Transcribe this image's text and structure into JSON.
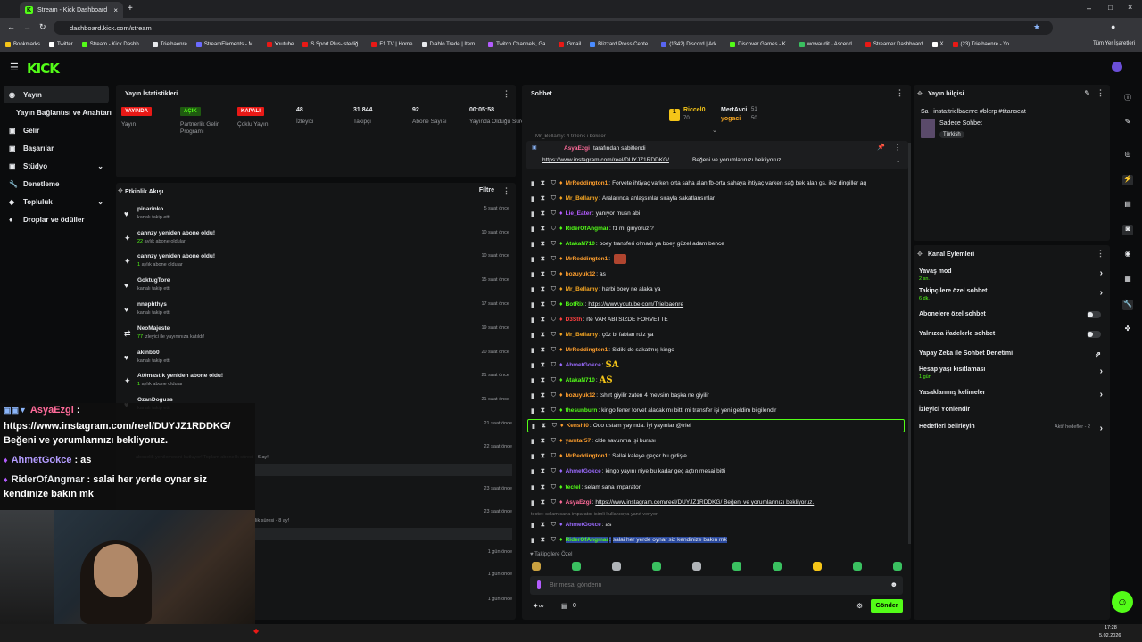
{
  "browser": {
    "tab_title": "Stream - Kick Dashboard",
    "url": "dashboard.kick.com/stream",
    "bookmarks": [
      "Bookmarks",
      "Twitter",
      "Stream - Kick Dashb...",
      "Trielbaenre",
      "StreamElements - M...",
      "Youtube",
      "S Sport Plus-İstediğ...",
      "F1 TV | Home",
      "Diablo Trade | Item...",
      "Twitch Channels, Ga...",
      "Gmail",
      "Blizzard Press Cente...",
      "(1342) Discord | Ark...",
      "Discover Games - K...",
      "wowaudit - Ascend...",
      "Streamer Dashboard",
      "X",
      "(23) Trielbaenre - Yo..."
    ],
    "bookmarks_right": "Tüm Yer İşaretleri"
  },
  "app": {
    "logo": "KICK"
  },
  "sidebar": {
    "items": [
      {
        "label": "Yayın"
      },
      {
        "label": "Yayın Bağlantısı ve Anahtarı"
      },
      {
        "label": "Gelir"
      },
      {
        "label": "Başarılar"
      },
      {
        "label": "Stüdyo"
      },
      {
        "label": "Denetleme"
      },
      {
        "label": "Topluluk"
      },
      {
        "label": "Droplar ve ödüller"
      }
    ]
  },
  "stats": {
    "title": "Yayın İstatistikleri",
    "items": [
      {
        "badge": "YAYINDA",
        "label": "Yayın",
        "color": "#e91916"
      },
      {
        "badge": "AÇIK",
        "label": "Partnerlik Gelir Programı",
        "color": "#53fc18"
      },
      {
        "badge": "KAPALI",
        "label": "Çoklu Yayın",
        "color": "#e91916"
      },
      {
        "value": "48",
        "label": "İzleyici"
      },
      {
        "value": "31.844",
        "label": "Takipçi"
      },
      {
        "value": "92",
        "label": "Abone Sayısı"
      },
      {
        "value": "00:05:58",
        "label": "Yayında Olduğu Süre"
      }
    ]
  },
  "activity": {
    "title": "Etkinlik Akışı",
    "filter": "Filtre",
    "items": [
      {
        "name": "pinarinko",
        "detail": "kanalı takip etti",
        "time": "5 saat önce",
        "icon": "♥"
      },
      {
        "name": "cannzy yeniden abone oldu!",
        "hl": "22",
        "detail": "aylık abone oldular",
        "time": "10 saat önce",
        "icon": "✦"
      },
      {
        "name": "cannzy yeniden abone oldu!",
        "hl": "1",
        "detail": "aylık abone oldular",
        "time": "10 saat önce",
        "icon": "✦"
      },
      {
        "name": "GoktugTore",
        "detail": "kanalı takip etti",
        "time": "15 saat önce",
        "icon": "♥"
      },
      {
        "name": "nnephthys",
        "detail": "kanalı takip etti",
        "time": "17 saat önce",
        "icon": "♥"
      },
      {
        "name": "NeoMajeste",
        "hl": "77",
        "detail": "izleyici ile yayınınıza katıldı!",
        "time": "19 saat önce",
        "icon": "⇄"
      },
      {
        "name": "akinbb0",
        "detail": "kanalı takip etti",
        "time": "20 saat önce",
        "icon": "♥"
      },
      {
        "name": "At0mastik yeniden abone oldu!",
        "hl": "1",
        "detail": "aylık abone oldular",
        "time": "21 saat önce",
        "icon": "✦"
      },
      {
        "name": "OzanDoguss",
        "detail": "kanalı takip etti",
        "time": "21 saat önce",
        "icon": "♥"
      }
    ],
    "extra_times": [
      "21 saat önce",
      "22 saat önce",
      "23 saat önce",
      "23 saat önce",
      "1 gün önce",
      "1 gün önce",
      "1 gün önce"
    ],
    "partial_texts": [
      "abonelik yenilemesini kutluyor! Toplam abonelik süresi - 6 ay!",
      "lik süresi - 8 ay!"
    ]
  },
  "chat": {
    "title": "Sohbet",
    "leaders": [
      {
        "name": "Riccel0",
        "score": "70"
      },
      {
        "name": "MertAvci",
        "score": "51"
      },
      {
        "name": "yogaci",
        "score": "50"
      }
    ],
    "pinned": {
      "by": "AsyaEzgi",
      "by_suffix": "tarafından sabitlendi",
      "link": "https://www.instagram.com/reel/DUYJZ1RDDKG/",
      "text": "Beğeni ve yorumlarınızı bekliyoruz."
    },
    "partial_top": "Mr_Bellamy: 4 trilenk i boksor",
    "messages": [
      {
        "user": "MrReddington1",
        "color": "#ff9f2e",
        "text": "Forvete ihtiyaç varken orta saha alan fb-orta sahaya ihtiyaç varken sağ bek alan gs, ikiz dingiller aq"
      },
      {
        "user": "Mr_Bellamy",
        "color": "#f5a623",
        "text": "Aralarında anlaşsınlar sırayla sakatlansınlar"
      },
      {
        "user": "Lie_Eater",
        "color": "#b45cff",
        "text": "yanıyor musn abi"
      },
      {
        "user": "RiderOfAngmar",
        "color": "#53fc18",
        "text": "f1 mi giriyoruz ?"
      },
      {
        "user": "AtakaN710",
        "color": "#53fc18",
        "text": "boey transferi olmadı ya boey güzel adam bence"
      },
      {
        "user": "MrReddington1",
        "color": "#ff9f2e",
        "text": ""
      },
      {
        "user": "bozuyuk12",
        "color": "#ff9f2e",
        "text": "as"
      },
      {
        "user": "Mr_Bellamy",
        "color": "#f5a623",
        "text": "harbi boey ne alaka ya"
      },
      {
        "user": "BotRix",
        "color": "#53fc18",
        "text": "https://www.youtube.com/Trielbaenre"
      },
      {
        "user": "D3Sth",
        "color": "#ff4040",
        "text": "rte VAR ABI SIZDE FORVETTE"
      },
      {
        "user": "Mr_Bellamy",
        "color": "#f5a623",
        "text": "çöz bi fabian ruiz ya"
      },
      {
        "user": "MrReddington1",
        "color": "#ff9f2e",
        "text": "Sidiki de sakatmış kingo"
      },
      {
        "user": "AhmetGokce",
        "color": "#9b6bff",
        "text": "SA"
      },
      {
        "user": "AtakaN710",
        "color": "#53fc18",
        "text": "AS"
      },
      {
        "user": "bozuyuk12",
        "color": "#ff9f2e",
        "text": "tshirt giyilir zaten 4 mevsim başka ne giyilir"
      },
      {
        "user": "thesunburn",
        "color": "#53fc18",
        "text": "kingo fener forvet alacak mı bitti mi transfer işi yeni geldim bilgilendir"
      },
      {
        "user": "Kenshi0",
        "color": "#ff9f2e",
        "text": "Ooo ustam yayında. İyi yayınlar @triel"
      },
      {
        "user": "yamtar57",
        "color": "#ff9f2e",
        "text": "clde savunma işi burası"
      },
      {
        "user": "MrReddington1",
        "color": "#ff9f2e",
        "text": "Sallai kaleye geçer bu gidişle"
      },
      {
        "user": "AhmetGokce",
        "color": "#9b6bff",
        "text": "kingo yayını niye bu kadar geç açtın mesai bitti"
      },
      {
        "user": "tectel",
        "color": "#53fc18",
        "text": "selam sana imparator"
      },
      {
        "user": "AsyaEzgi",
        "color": "#ff6b9a",
        "text": "https://www.instagram.com/reel/DUYJZ1RDDKG/ Beğeni ve yorumlarınızı bekliyoruz."
      },
      {
        "user": "AhmetGokce",
        "color": "#9b6bff",
        "text": "as"
      },
      {
        "user": "RiderOfAngmar",
        "color": "#53fc18",
        "text": "salai her yerde oynar siz kendinize bakın mk"
      }
    ],
    "reply_hint": "tectel: selam sana imparator isimli kullanıcıya yanıt veriyor",
    "followers_only": "Takipçilere Özel",
    "input_placeholder": "Bir mesaj gönderin",
    "points": "0",
    "send": "Gönder"
  },
  "stream_info": {
    "title": "Yayın bilgisi",
    "stream_title": "Sa | insta:trielbaenre #blerp #titanseat",
    "category": "Sadece Sohbet",
    "tag": "Türkish"
  },
  "channel_actions": {
    "title": "Kanal Eylemleri",
    "items": [
      {
        "label": "Yavaş mod",
        "sub": "2 sn.",
        "type": "chev"
      },
      {
        "label": "Takipçilere özel sohbet",
        "sub": "6 dk.",
        "type": "chev"
      },
      {
        "label": "Abonelere özel sohbet",
        "sub": "",
        "type": "toggle"
      },
      {
        "label": "Yalnızca ifadelerle sohbet",
        "sub": "",
        "type": "toggle"
      },
      {
        "label": "Yapay Zeka ile Sohbet Denetimi",
        "sub": "",
        "type": "ext"
      },
      {
        "label": "Hesap yaşı kısıtlaması",
        "sub": "1 gün",
        "type": "chev"
      },
      {
        "label": "Yasaklanmış kelimeler",
        "sub": "",
        "type": "chev"
      },
      {
        "label": "İzleyici Yönlendir",
        "sub": "",
        "type": "none"
      },
      {
        "label": "Hedefleri belirleyin",
        "sub": "",
        "type": "chev",
        "right_text": "Aktif hedefler - 2"
      }
    ]
  },
  "overlay": {
    "lines": [
      {
        "user": "AsyaEzgi",
        "text": ":"
      },
      {
        "text": "https://www.instagram.com/reel/DUYJZ1RDDKG/"
      },
      {
        "text": "Beğeni ve yorumlarınızı bekliyoruz."
      },
      {
        "user": "AhmetGokce",
        "text": ": as"
      },
      {
        "user": "RiderOfAngmar",
        "text": ": salai her yerde oynar siz"
      },
      {
        "text": "kendinize bakın mk"
      }
    ]
  },
  "taskbar": {
    "time": "17:28",
    "date": "5.02.2026"
  }
}
